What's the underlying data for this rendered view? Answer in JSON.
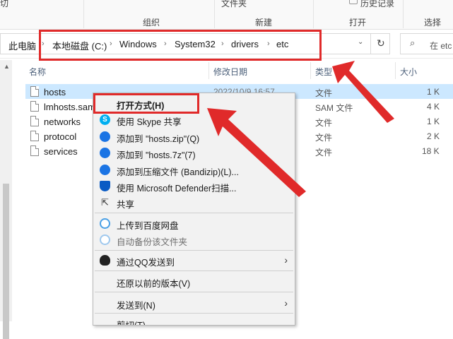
{
  "ribbon": {
    "top_left_fragment": "切",
    "top_folder_fragment": "文件夹",
    "history_label": "历史记录",
    "group_labels": [
      "组织",
      "新建",
      "打开",
      "选择"
    ]
  },
  "address": {
    "crumbs": [
      "此电脑",
      "本地磁盘 (C:)",
      "Windows",
      "System32",
      "drivers",
      "etc"
    ],
    "search_placeholder": "在 etc"
  },
  "columns": {
    "name": "名称",
    "modified": "修改日期",
    "type": "类型",
    "size": "大小"
  },
  "files": [
    {
      "name": "hosts",
      "modified": "2022/10/9 16:57",
      "type": "文件",
      "size": "1 K",
      "selected": true
    },
    {
      "name": "lmhosts.sam",
      "modified": "",
      "type": "SAM 文件",
      "size": "4 K",
      "selected": false
    },
    {
      "name": "networks",
      "modified": "",
      "type": "文件",
      "size": "1 K",
      "selected": false
    },
    {
      "name": "protocol",
      "modified": "",
      "type": "文件",
      "size": "2 K",
      "selected": false
    },
    {
      "name": "services",
      "modified": "",
      "type": "文件",
      "size": "18 K",
      "selected": false
    }
  ],
  "context_menu": {
    "open_with": "打开方式(H)",
    "skype_share": "使用 Skype 共享",
    "add_zip": "添加到 \"hosts.zip\"(Q)",
    "add_7z": "添加到 \"hosts.7z\"(7)",
    "add_bandizip": "添加到压缩文件 (Bandizip)(L)...",
    "defender": "使用 Microsoft Defender扫描...",
    "share": "共享",
    "baidu_upload": "上传到百度网盘",
    "baidu_backup": "自动备份该文件夹",
    "qq_send": "通过QQ发送到",
    "restore": "还原以前的版本(V)",
    "send_to": "发送到(N)",
    "cut_fragment": "剪切(T)"
  },
  "colors": {
    "selection": "#cce8ff",
    "annotation_red": "#e02a2a",
    "bandizip_blue": "#1b74e4",
    "defender_blue": "#0a5bc4",
    "skype_blue": "#00aff0"
  }
}
